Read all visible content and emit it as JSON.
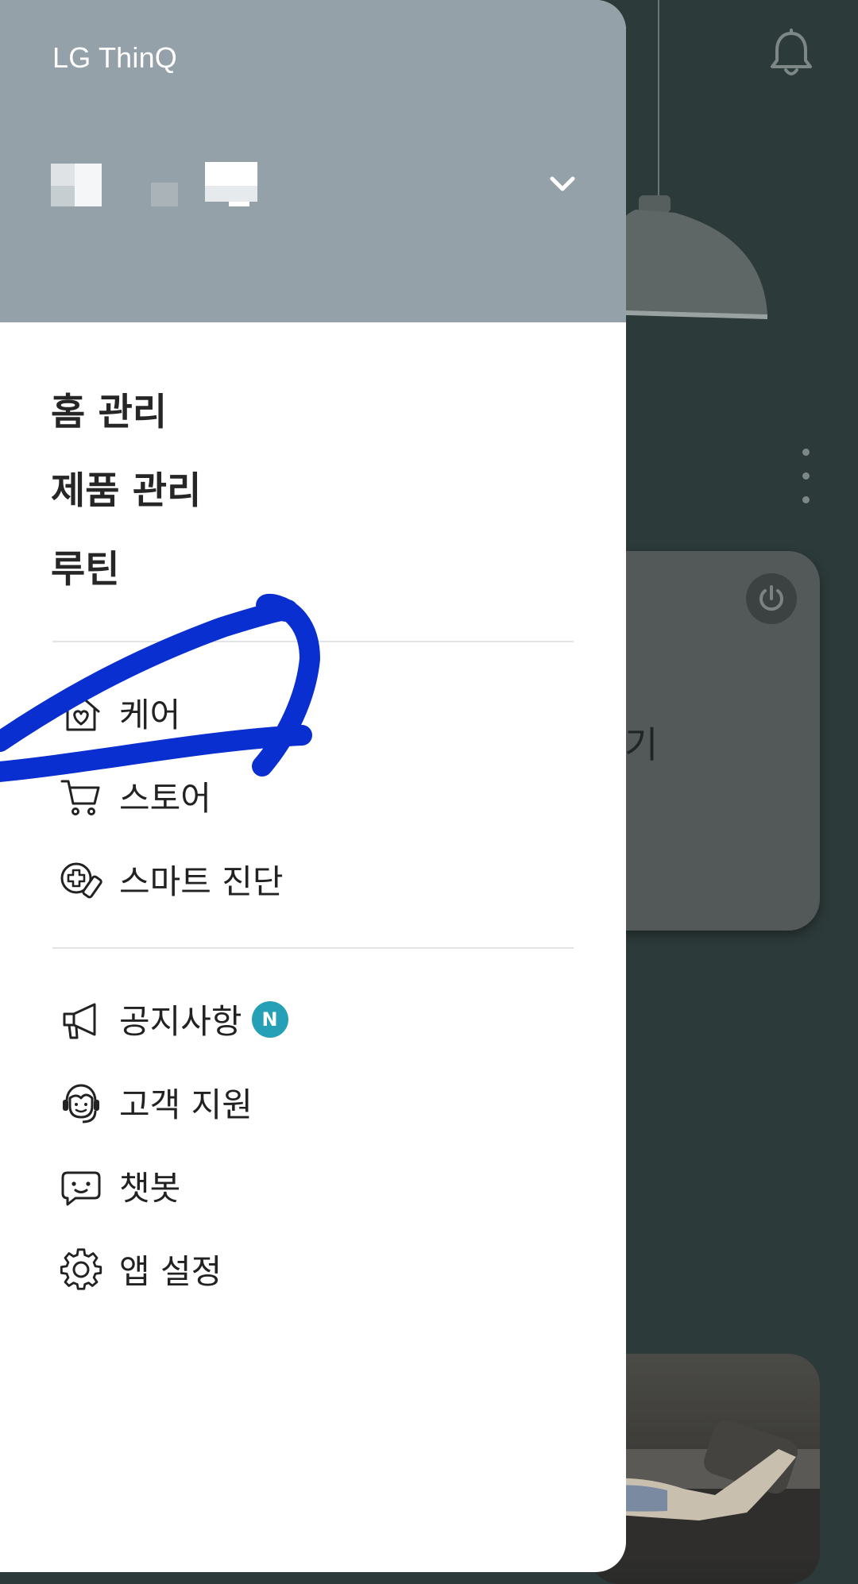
{
  "app": {
    "title": "LG ThinQ"
  },
  "home_selector": {
    "icon": "chevron-down-icon"
  },
  "nav_main": [
    {
      "label": "홈 관리"
    },
    {
      "label": "제품 관리"
    },
    {
      "label": "루틴"
    }
  ],
  "nav_services": [
    {
      "label": "케어",
      "icon": "home-heart-icon"
    },
    {
      "label": "스토어",
      "icon": "cart-icon"
    },
    {
      "label": "스마트 진단",
      "icon": "smart-diagnosis-icon"
    }
  ],
  "nav_support": [
    {
      "label": "공지사항",
      "icon": "megaphone-icon",
      "badge": "N"
    },
    {
      "label": "고객 지원",
      "icon": "headset-agent-icon"
    },
    {
      "label": "챗봇",
      "icon": "chatbot-icon"
    },
    {
      "label": "앱 설정",
      "icon": "gear-icon"
    }
  ],
  "background": {
    "device_card_partial_text": "기"
  },
  "colors": {
    "header_bg": "#95a1a8",
    "badge_bg": "#26a0b6",
    "annotation_stroke": "#0a2fd0",
    "background_app": "#2c3a39"
  }
}
